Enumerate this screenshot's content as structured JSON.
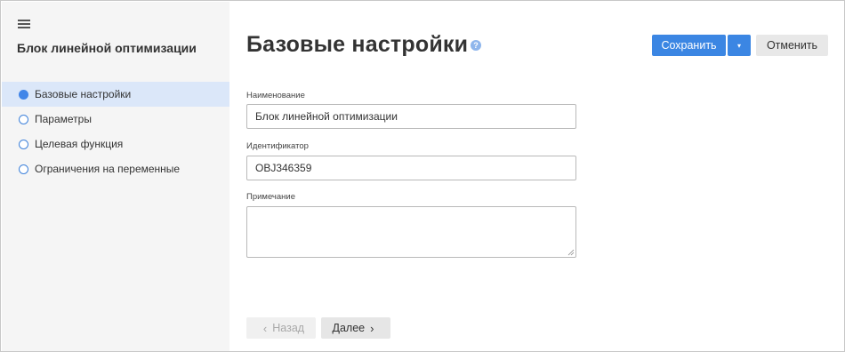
{
  "sidebar": {
    "title": "Блок линейной оптимизации",
    "items": [
      {
        "label": "Базовые настройки",
        "active": true
      },
      {
        "label": "Параметры",
        "active": false
      },
      {
        "label": "Целевая функция",
        "active": false
      },
      {
        "label": "Ограничения на переменные",
        "active": false
      }
    ]
  },
  "header": {
    "title": "Базовые настройки",
    "help": "?",
    "save_label": "Сохранить",
    "save_dropdown": "▾",
    "cancel_label": "Отменить"
  },
  "form": {
    "name_label": "Наименование",
    "name_value": "Блок линейной оптимизации",
    "id_label": "Идентификатор",
    "id_value": "OBJ346359",
    "note_label": "Примечание",
    "note_value": ""
  },
  "footer": {
    "back_label": "Назад",
    "next_label": "Далее"
  },
  "colors": {
    "accent": "#3b86e3",
    "sidebar_bg": "#f5f5f5",
    "active_item_bg": "#dbe7f9"
  }
}
